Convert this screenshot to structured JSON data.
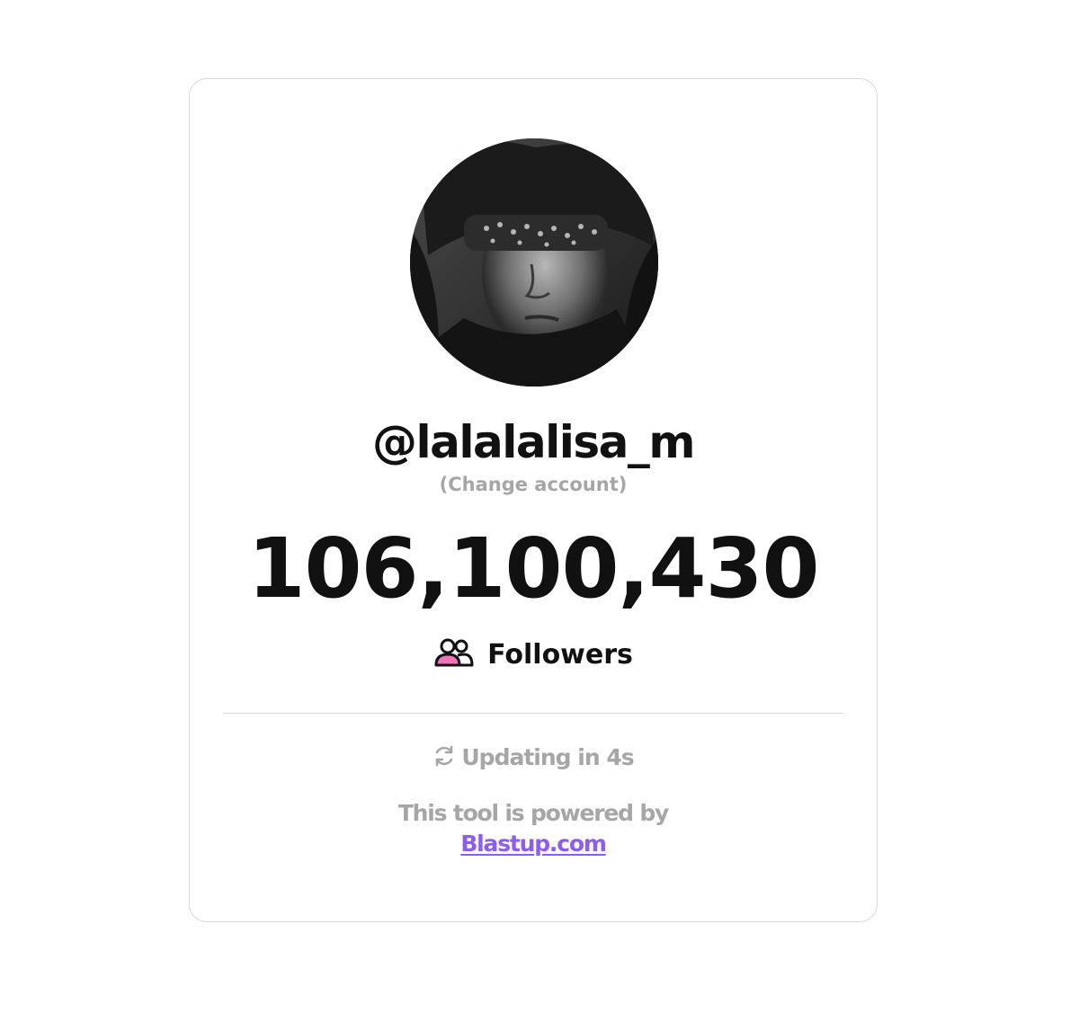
{
  "profile": {
    "username": "@lalalalisa_m",
    "change_account_label": "(Change account)",
    "avatar_icon": "profile-photo"
  },
  "stats": {
    "follower_count": "106,100,430",
    "followers_label": "Followers",
    "followers_icon": "users-icon"
  },
  "status": {
    "updating_text": "Updating in 4s",
    "refresh_icon": "refresh-icon"
  },
  "footer": {
    "powered_by_text": "This tool is powered by",
    "link_text": "Blastup.com"
  },
  "colors": {
    "text_primary": "#111111",
    "text_muted": "#a6a6a6",
    "link": "#8b5cf6",
    "icon_accent": "#f472b6",
    "border": "#d9d9d9"
  }
}
